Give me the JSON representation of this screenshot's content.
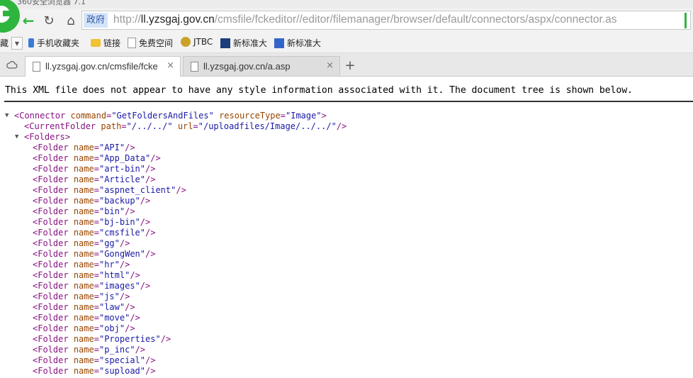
{
  "window": {
    "title": "360安全浏览器 7.1"
  },
  "address_bar": {
    "badge": "政府",
    "url_scheme": "http://",
    "url_host": "ll.yzsgaj.gov.cn",
    "url_path": "/cmsfile/fckeditor//editor/filemanager/browser/default/connectors/aspx/connector.as"
  },
  "bookmarks": {
    "favorites": "藏",
    "phone": "手机收藏夹",
    "links": "链接",
    "free_space": "免费空间",
    "jtbc": "JTBC",
    "news1": "新标准大",
    "news2": "新标准大",
    "news2_icon_glyph": "🐾"
  },
  "tabs": [
    {
      "label": "ll.yzsgaj.gov.cn/cmsfile/fcke",
      "close": "×"
    },
    {
      "label": "ll.yzsgaj.gov.cn/a.asp",
      "close": "×"
    }
  ],
  "new_tab": "+",
  "content": {
    "notice": "This XML file does not appear to have any style information associated with it. The document tree is shown below.",
    "toggle": "▼",
    "connector": {
      "tag": "Connector",
      "command": "GetFoldersAndFiles",
      "resourceType": "Image"
    },
    "current_folder": {
      "tag": "CurrentFolder",
      "path": "/../../",
      "url": "/uploadfiles/Image/../../"
    },
    "folders_tag": "Folders",
    "folder_tag": "Folder",
    "folders": [
      "API",
      "App_Data",
      "art-bin",
      "Article",
      "aspnet_client",
      "backup",
      "bin",
      "bj-bin",
      "cmsfile",
      "gg",
      "GongWen",
      "hr",
      "html",
      "images",
      "js",
      "law",
      "move",
      "obj",
      "Properties",
      "p_inc",
      "special",
      "supload"
    ]
  },
  "colors": {
    "accent": "#2eb53e",
    "xml_tag": "#881280",
    "xml_attr": "#994500",
    "xml_value": "#1a1aa6"
  }
}
